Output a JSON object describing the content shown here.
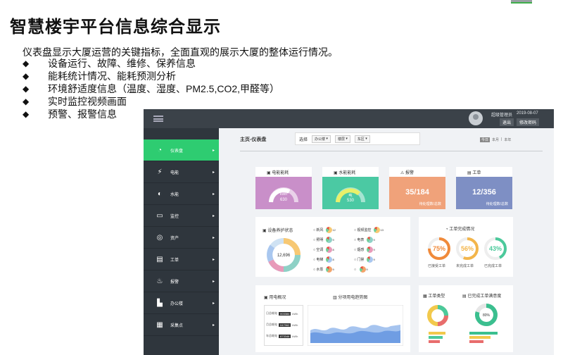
{
  "slide": {
    "title": "智慧楼宇平台信息综合显示",
    "description": "仪表盘显示大厦运营的关键指标，全面直观的展示大厦的整体运行情况。",
    "bullet_mark": "◆",
    "bullets": [
      "设备运行、故障、维修、保养信息",
      "能耗统计情况、能耗预测分析",
      "环境舒适度信息（温度、湿度、PM2.5,CO2,甲醛等）",
      "实时监控视频画面",
      "预警、报警信息"
    ]
  },
  "dashboard": {
    "header": {
      "user": "超级管理员",
      "date": "2019-08-07",
      "logout": "退出",
      "change_password": "修改密码"
    },
    "sidebar": {
      "items": [
        {
          "label": "仪表盘",
          "icon": "gauge-icon",
          "active": true
        },
        {
          "label": "电能",
          "icon": "power-icon"
        },
        {
          "label": "水能",
          "icon": "water-drop-icon"
        },
        {
          "label": "监控",
          "icon": "monitor-icon"
        },
        {
          "label": "资产",
          "icon": "asset-icon"
        },
        {
          "label": "工单",
          "icon": "workorder-icon"
        },
        {
          "label": "报警",
          "icon": "alarm-icon"
        },
        {
          "label": "办公楼",
          "icon": "building-icon"
        },
        {
          "label": "采集点",
          "icon": "collect-point-icon"
        }
      ],
      "arrow": "▸"
    },
    "breadcrumb": "主页-仪表盘",
    "filter": {
      "label": "选择",
      "selects": [
        "办公楼",
        "楼层",
        "东区"
      ]
    },
    "ranges": [
      "今日",
      "本月",
      "本年"
    ],
    "stat_cards": [
      {
        "title": "电能能耗",
        "value": "kWh\n630",
        "unit": "kWh",
        "number": "630",
        "color": "#c98fc9"
      },
      {
        "title": "水能能耗",
        "value": "530",
        "unit": "吨",
        "number": "530",
        "color": "#4bc9a3"
      },
      {
        "title": "报警",
        "value": "35/184",
        "note": "待处理数/总数",
        "color": "#f0a27a"
      },
      {
        "title": "工单",
        "value": "12/356",
        "note": "待处理数/总数",
        "color": "#7e8fc4"
      }
    ],
    "device_status": {
      "title": "设备养护状态",
      "total": "12,696",
      "items": [
        {
          "name": "新风",
          "count": "12"
        },
        {
          "name": "照明",
          "count": "9"
        },
        {
          "name": "空调",
          "count": "8"
        },
        {
          "name": "电梯",
          "count": "8"
        },
        {
          "name": "水泵",
          "count": "9"
        },
        {
          "name": "视频监控",
          "count": "13"
        },
        {
          "name": "电表",
          "count": "9"
        },
        {
          "name": "烟感",
          "count": "9"
        },
        {
          "name": "门禁",
          "count": "9"
        },
        {
          "name": "",
          "count": "9"
        }
      ]
    },
    "work_completion": {
      "title": "工单完成情况",
      "kpis": [
        {
          "value": "75%",
          "caption": "已接受工单",
          "color": "#f08a3a",
          "fraction": 0.75
        },
        {
          "value": "56%",
          "caption": "未完成工单",
          "color": "#f3b54a",
          "fraction": 0.56
        },
        {
          "value": "43%",
          "caption": "已完成工单",
          "color": "#4bc99b",
          "fraction": 0.43
        }
      ]
    },
    "power_overview": {
      "title": "用电概况",
      "rows": [
        {
          "label": "日总耗电",
          "value": "003384",
          "unit": "kWh"
        },
        {
          "label": "月总耗电",
          "value": "047962",
          "unit": "kWh"
        },
        {
          "label": "年总耗电",
          "value": "873346",
          "unit": "kWh"
        }
      ]
    },
    "power_trend": {
      "title": "分项用电趋势图"
    },
    "work_type": {
      "title": "工单类型"
    },
    "satisfaction": {
      "title": "已完成工单满意度",
      "center": "80%"
    }
  }
}
